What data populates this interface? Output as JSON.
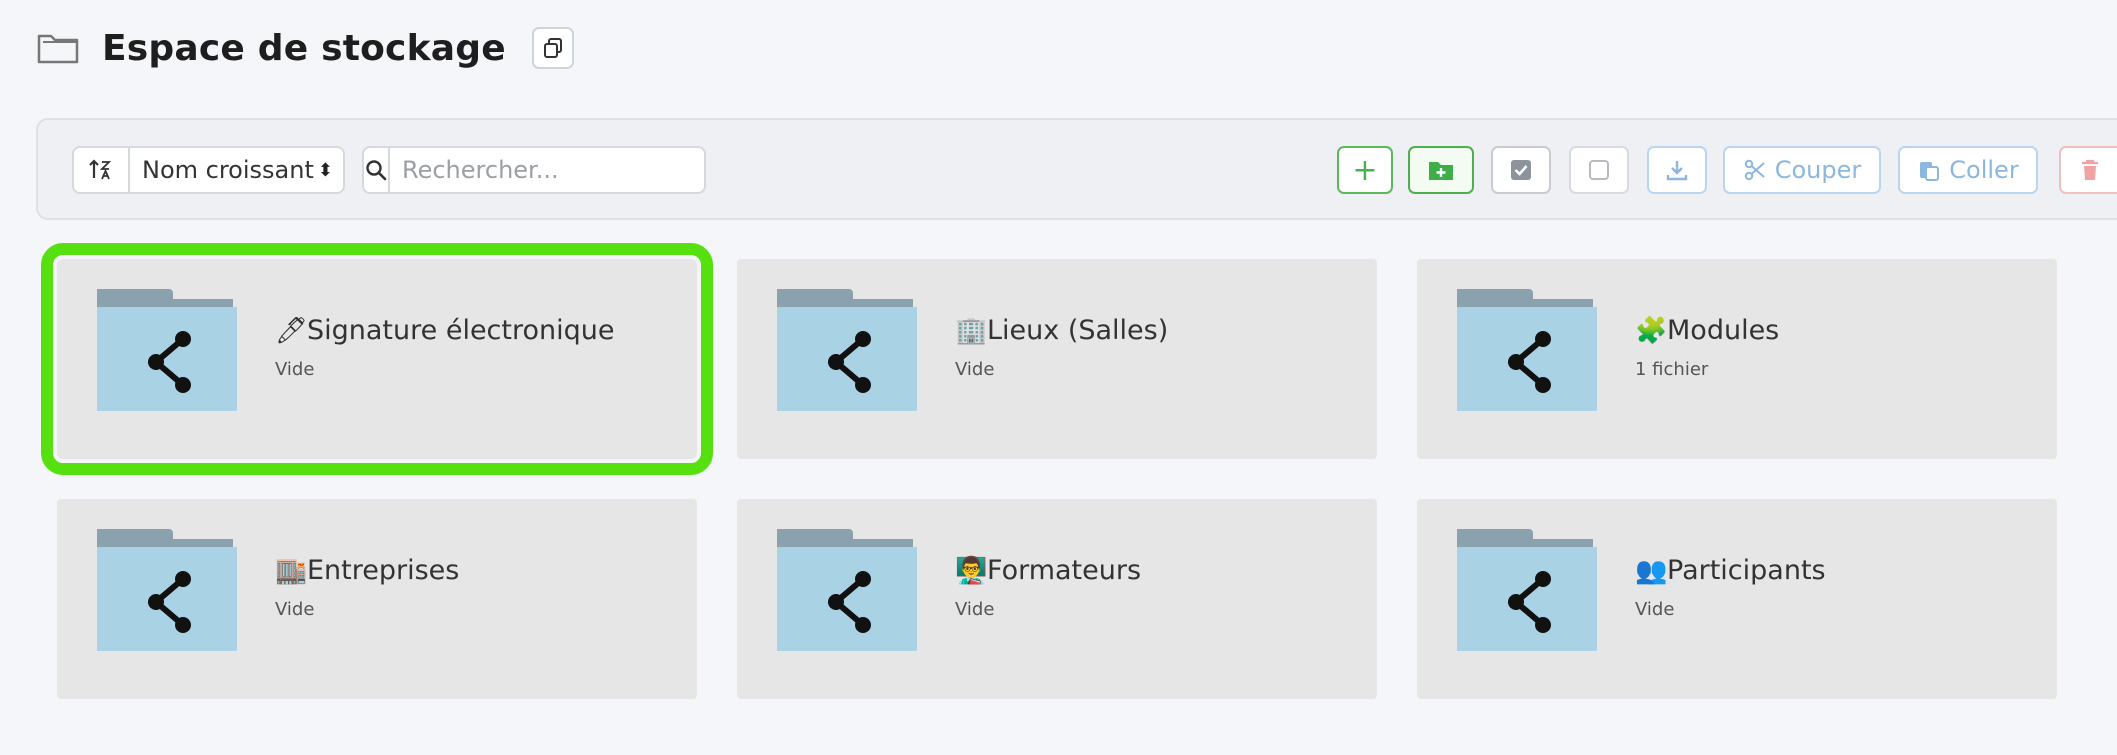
{
  "header": {
    "title": "Espace de stockage"
  },
  "toolbar": {
    "sort_label": "Nom croissant",
    "search_placeholder": "Rechercher...",
    "cut_label": "Couper",
    "paste_label": "Coller"
  },
  "folders": [
    {
      "emoji": "🖊",
      "name": "Signature électronique",
      "subtitle": "Vide"
    },
    {
      "emoji": "🏢",
      "name": "Lieux (Salles)",
      "subtitle": "Vide"
    },
    {
      "emoji": "🧩",
      "name": "Modules",
      "subtitle": "1 fichier"
    },
    {
      "emoji": "🏬",
      "name": "Entreprises",
      "subtitle": "Vide"
    },
    {
      "emoji": "👨‍🏫",
      "name": "Formateurs",
      "subtitle": "Vide"
    },
    {
      "emoji": "👥",
      "name": "Participants",
      "subtitle": "Vide"
    }
  ],
  "colors": {
    "selection_outline": "#56e00f",
    "folder_body": "#a9d3e4",
    "folder_tab": "#8aa2ae",
    "tile_background": "#e6e6e6"
  }
}
